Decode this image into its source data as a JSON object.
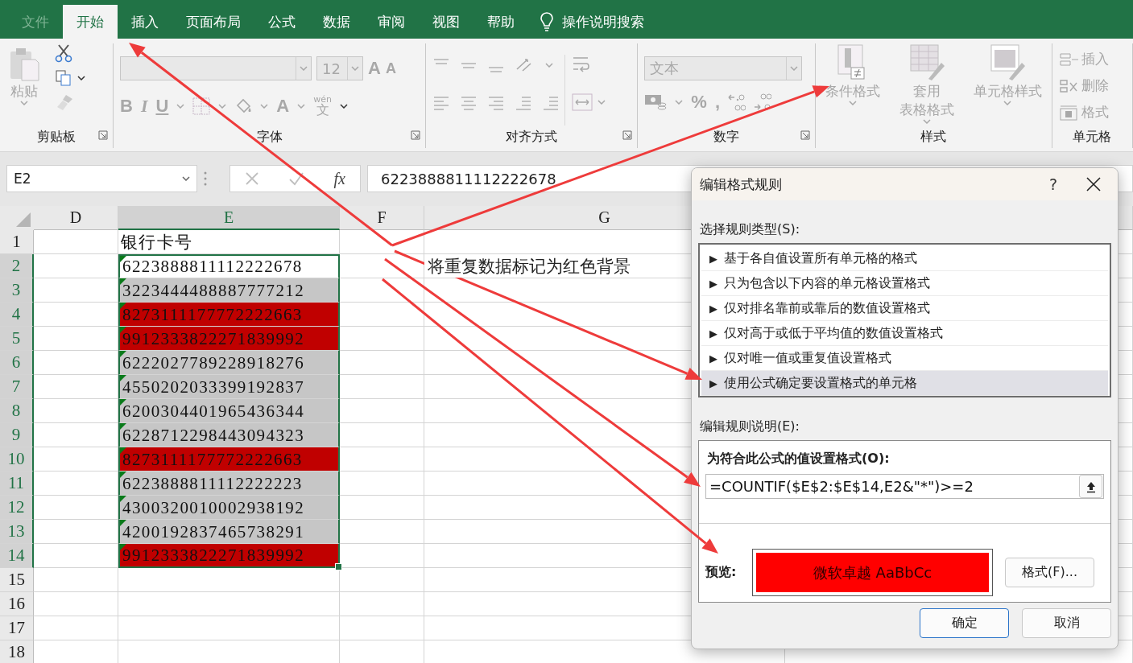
{
  "tabs": [
    {
      "label": "文件",
      "selected": false,
      "kind": "file"
    },
    {
      "label": "开始",
      "selected": true,
      "kind": "tab"
    },
    {
      "label": "插入",
      "selected": false,
      "kind": "tab"
    },
    {
      "label": "页面布局",
      "selected": false,
      "kind": "tab"
    },
    {
      "label": "公式",
      "selected": false,
      "kind": "tab"
    },
    {
      "label": "数据",
      "selected": false,
      "kind": "tab"
    },
    {
      "label": "审阅",
      "selected": false,
      "kind": "tab"
    },
    {
      "label": "视图",
      "selected": false,
      "kind": "tab"
    },
    {
      "label": "帮助",
      "selected": false,
      "kind": "tab"
    }
  ],
  "tell_me": "操作说明搜索",
  "ribbon": {
    "disabled": true,
    "clipboard": {
      "label": "剪贴板",
      "paste": "粘贴"
    },
    "font": {
      "label": "字体",
      "size": "12",
      "grow": "A",
      "shrink": "A",
      "styles": [
        "B",
        "I",
        "U"
      ],
      "font_color": "A",
      "phonetic_top": "wén",
      "phonetic": "文"
    },
    "alignment": {
      "label": "对齐方式"
    },
    "number": {
      "label": "数字",
      "format": "文本",
      "percent": "%",
      "comma": ","
    },
    "styles": {
      "label": "样式",
      "buttons": [
        {
          "lines": [
            "条件格式"
          ],
          "kind": "conditional"
        },
        {
          "lines": [
            "套用",
            "表格格式"
          ],
          "kind": "table"
        },
        {
          "lines": [
            "单元格样式"
          ],
          "kind": "cell"
        }
      ]
    },
    "cells": {
      "label": "单元格",
      "buttons": [
        {
          "label": "插入",
          "kind": "insert"
        },
        {
          "label": "删除",
          "kind": "delete"
        },
        {
          "label": "格式",
          "kind": "format"
        }
      ]
    }
  },
  "formula_bar": {
    "name_box": "E2",
    "function_label": "fx",
    "value": "6223888811112222678"
  },
  "sheet": {
    "columns": [
      {
        "label": "D",
        "selected": false
      },
      {
        "label": "E",
        "selected": true
      },
      {
        "label": "F",
        "selected": false
      },
      {
        "label": "G",
        "selected": false
      }
    ],
    "rows": [
      {
        "header": "1",
        "selected": false,
        "e": {
          "text": "银行卡号",
          "flag": false
        }
      },
      {
        "header": "2",
        "selected": true,
        "e": {
          "text": "6223888811112222678",
          "flag": true
        },
        "g": "将重复数据标记为红色背景"
      },
      {
        "header": "3",
        "selected": true,
        "e": {
          "text": "3223444488887777212",
          "flag": true,
          "color": "#c6c6c6"
        }
      },
      {
        "header": "4",
        "selected": true,
        "e": {
          "text": "8273111177772222663",
          "flag": true,
          "color": "#c00000"
        }
      },
      {
        "header": "5",
        "selected": true,
        "e": {
          "text": "9912333822271839992",
          "flag": true,
          "color": "#c00000"
        }
      },
      {
        "header": "6",
        "selected": true,
        "e": {
          "text": "6222027789228918276",
          "flag": true,
          "color": "#c6c6c6"
        }
      },
      {
        "header": "7",
        "selected": true,
        "e": {
          "text": "4550202033399192837",
          "flag": true,
          "color": "#c6c6c6"
        }
      },
      {
        "header": "8",
        "selected": true,
        "e": {
          "text": "6200304401965436344",
          "flag": true,
          "color": "#c6c6c6"
        }
      },
      {
        "header": "9",
        "selected": true,
        "e": {
          "text": "6228712298443094323",
          "flag": true,
          "color": "#c6c6c6"
        }
      },
      {
        "header": "10",
        "selected": true,
        "e": {
          "text": "8273111177772222663",
          "flag": true,
          "color": "#c00000"
        }
      },
      {
        "header": "11",
        "selected": true,
        "e": {
          "text": "6223888811112222223",
          "flag": true,
          "color": "#c6c6c6"
        }
      },
      {
        "header": "12",
        "selected": true,
        "e": {
          "text": "4300320010002938192",
          "flag": true,
          "color": "#c6c6c6"
        }
      },
      {
        "header": "13",
        "selected": true,
        "e": {
          "text": "4200192837465738291",
          "flag": true,
          "color": "#c6c6c6"
        }
      },
      {
        "header": "14",
        "selected": true,
        "e": {
          "text": "9912333822271839992",
          "flag": true,
          "color": "#c00000"
        }
      },
      {
        "header": "15",
        "selected": false
      },
      {
        "header": "16",
        "selected": false
      },
      {
        "header": "17",
        "selected": false
      },
      {
        "header": "18",
        "selected": false
      }
    ]
  },
  "dialog": {
    "title": "编辑格式规则",
    "help": "?",
    "rule_type_label": "选择规则类型(S):",
    "rule_types": [
      {
        "label": "基于各自值设置所有单元格的格式",
        "selected": false
      },
      {
        "label": "只为包含以下内容的单元格设置格式",
        "selected": false
      },
      {
        "label": "仅对排名靠前或靠后的数值设置格式",
        "selected": false
      },
      {
        "label": "仅对高于或低于平均值的数值设置格式",
        "selected": false
      },
      {
        "label": "仅对唯一值或重复值设置格式",
        "selected": false
      },
      {
        "label": "使用公式确定要设置格式的单元格",
        "selected": true
      }
    ],
    "bullet": "▶",
    "description_label": "编辑规则说明(E):",
    "formula_label": "为符合此公式的值设置格式(O):",
    "formula": "=COUNTIF($E$2:$E$14,E2&\"*\")>=2",
    "preview_label": "预览:",
    "preview_text": "微软卓越  AaBbCc",
    "format_button": "格式(F)...",
    "buttons": [
      {
        "label": "确定",
        "default": true
      },
      {
        "label": "取消",
        "default": false
      }
    ]
  }
}
